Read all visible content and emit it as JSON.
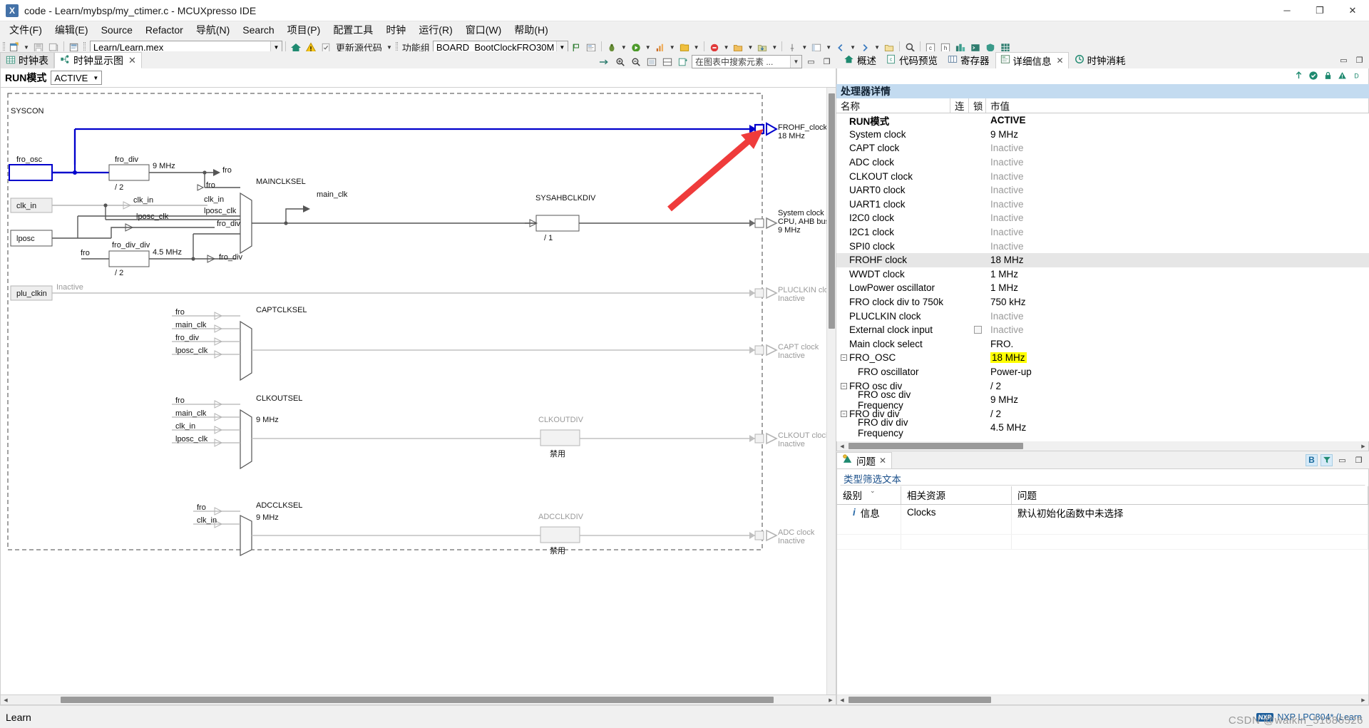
{
  "window": {
    "title": "code - Learn/mybsp/my_ctimer.c - MCUXpresso IDE",
    "app_icon": "X",
    "minimize": "─",
    "maximize": "❐",
    "close": "✕"
  },
  "menubar": {
    "items": [
      "文件(F)",
      "编辑(E)",
      "Source",
      "Refactor",
      "导航(N)",
      "Search",
      "项目(P)",
      "配置工具",
      "时钟",
      "运行(R)",
      "窗口(W)",
      "帮助(H)"
    ]
  },
  "toolbar": {
    "path_value": "Learn/Learn.mex",
    "update_code_label": "更新源代码",
    "function_group_label": "功能组",
    "function_group_value": "BOARD_BootClockFRO30M"
  },
  "editor": {
    "tabs": [
      {
        "label": "时钟表",
        "icon": "table-icon",
        "active": false,
        "closable": false
      },
      {
        "label": "时钟显示图",
        "icon": "diagram-icon",
        "active": true,
        "closable": true
      }
    ],
    "search_placeholder": "在图表中搜索元素 ...",
    "run_mode_label": "RUN模式",
    "run_mode_value": "ACTIVE"
  },
  "diagram": {
    "section_label": "SYSCON",
    "blocks": [
      {
        "name": "fro_osc",
        "label": "fro_osc",
        "sub": ""
      },
      {
        "name": "fro_div",
        "label": "fro_div",
        "sub": "/ 2",
        "out": "9 MHz"
      },
      {
        "name": "clk_in",
        "label": "clk_in",
        "sub": ""
      },
      {
        "name": "lposc",
        "label": "lposc",
        "sub": ""
      },
      {
        "name": "fro_div_div",
        "label": "fro_div_div",
        "sub": "/ 2",
        "out": "4.5 MHz"
      },
      {
        "name": "plu_clkin",
        "label": "plu_clkin",
        "sub": "Inactive"
      },
      {
        "name": "SYSAHBCLKDIV",
        "label": "SYSAHBCLKDIV",
        "sub": "/ 1"
      },
      {
        "name": "CLKOUTDIV",
        "label": "CLKOUTDIV",
        "sub": "禁用",
        "freq": "9 MHz"
      },
      {
        "name": "ADCCLKDIV",
        "label": "ADCCLKDIV",
        "sub": "禁用",
        "freq": "9 MHz"
      }
    ],
    "muxes": [
      {
        "name": "MAINCLKSEL",
        "inputs": [
          "clk_in",
          "fro",
          "lposc_clk",
          "fro_div"
        ],
        "output": "main_clk"
      },
      {
        "name": "CAPTCLKSEL",
        "inputs": [
          "fro",
          "main_clk",
          "fro_div",
          "lposc_clk"
        ],
        "output": ""
      },
      {
        "name": "CLKOUTSEL",
        "inputs": [
          "fro",
          "main_clk",
          "clk_in",
          "lposc_clk"
        ],
        "output": ""
      },
      {
        "name": "ADCCLKSEL",
        "inputs": [
          "fro",
          "clk_in"
        ],
        "output": ""
      }
    ],
    "signals": {
      "fro": "fro",
      "fro2": "fro",
      "clk_in": "clk_in",
      "lposc_clk": "lposc_clk",
      "fro_div": "fro_div",
      "main_clk": "main_clk",
      "fro_label": "fro",
      "fro_div_label": "fro_div"
    },
    "outputs": [
      {
        "name": "FROHF_clock",
        "title": "FROHF_clock",
        "sub": "18 MHz",
        "state": "active-blue"
      },
      {
        "name": "System_clock",
        "title": "System clock",
        "sub": "CPU, AHB bus, :",
        "sub2": "9 MHz",
        "state": "active"
      },
      {
        "name": "PLUCLKIN_clock",
        "title": "PLUCLKIN cloc",
        "sub": "Inactive",
        "state": "inactive"
      },
      {
        "name": "CAPT_clock",
        "title": "CAPT clock",
        "sub": "Inactive",
        "state": "inactive"
      },
      {
        "name": "CLKOUT_clock",
        "title": "CLKOUT clock",
        "sub": "Inactive",
        "state": "inactive"
      },
      {
        "name": "ADC_clock",
        "title": "ADC clock",
        "sub": "Inactive",
        "state": "inactive"
      }
    ]
  },
  "right_panel": {
    "tabs": [
      {
        "label": "概述",
        "icon": "home-icon",
        "active": false,
        "closable": false
      },
      {
        "label": "代码预览",
        "icon": "code-icon",
        "active": false,
        "closable": false
      },
      {
        "label": "寄存器",
        "icon": "register-icon",
        "active": false,
        "closable": false
      },
      {
        "label": "详细信息",
        "icon": "details-icon",
        "active": true,
        "closable": true
      },
      {
        "label": "时钟消耗",
        "icon": "consumption-icon",
        "active": false,
        "closable": false
      }
    ],
    "section_title": "处理器详情",
    "columns": [
      "名称",
      "连",
      "锁",
      "市值"
    ],
    "rows": [
      {
        "name": "RUN模式",
        "value": "ACTIVE",
        "bold": true,
        "indent": 1,
        "state": "normal"
      },
      {
        "name": "System clock",
        "value": "9 MHz",
        "indent": 1,
        "state": "normal"
      },
      {
        "name": "CAPT clock",
        "value": "Inactive",
        "indent": 1,
        "state": "inactive"
      },
      {
        "name": "ADC clock",
        "value": "Inactive",
        "indent": 1,
        "state": "inactive"
      },
      {
        "name": "CLKOUT clock",
        "value": "Inactive",
        "indent": 1,
        "state": "inactive"
      },
      {
        "name": "UART0 clock",
        "value": "Inactive",
        "indent": 1,
        "state": "inactive"
      },
      {
        "name": "UART1 clock",
        "value": "Inactive",
        "indent": 1,
        "state": "inactive"
      },
      {
        "name": "I2C0 clock",
        "value": "Inactive",
        "indent": 1,
        "state": "inactive"
      },
      {
        "name": "I2C1 clock",
        "value": "Inactive",
        "indent": 1,
        "state": "inactive"
      },
      {
        "name": "SPI0 clock",
        "value": "Inactive",
        "indent": 1,
        "state": "inactive"
      },
      {
        "name": "FROHF clock",
        "value": "18 MHz",
        "indent": 1,
        "state": "selected"
      },
      {
        "name": "WWDT clock",
        "value": "1 MHz",
        "indent": 1,
        "state": "normal"
      },
      {
        "name": "LowPower oscillator",
        "value": "1 MHz",
        "indent": 1,
        "state": "normal"
      },
      {
        "name": "FRO clock div to 750k",
        "value": "750 kHz",
        "indent": 1,
        "state": "normal"
      },
      {
        "name": "PLUCLKIN clock",
        "value": "Inactive",
        "indent": 1,
        "state": "inactive"
      },
      {
        "name": "External clock input",
        "value": "Inactive",
        "indent": 1,
        "state": "inactive",
        "lock": true
      },
      {
        "name": "Main clock select",
        "value": "FRO.",
        "indent": 1,
        "state": "normal"
      },
      {
        "name": "FRO_OSC",
        "value": "18 MHz",
        "indent": 0,
        "state": "highlight",
        "twisty": "−"
      },
      {
        "name": "FRO oscillator",
        "value": "Power-up",
        "indent": 2,
        "state": "normal"
      },
      {
        "name": "FRO osc div",
        "value": "/ 2",
        "indent": 0,
        "state": "normal",
        "twisty": "−"
      },
      {
        "name": "FRO osc div Frequency",
        "value": "9 MHz",
        "indent": 2,
        "state": "normal"
      },
      {
        "name": "FRO div div",
        "value": "/ 2",
        "indent": 0,
        "state": "normal",
        "twisty": "−"
      },
      {
        "name": "FRO div div Frequency",
        "value": "4.5 MHz",
        "indent": 2,
        "state": "normal"
      }
    ]
  },
  "problems": {
    "tab_label": "问题",
    "filter_placeholder": "类型筛选文本",
    "toggle_b": "B",
    "columns": [
      "级别",
      "相关资源",
      "问题"
    ],
    "rows": [
      {
        "level": "信息",
        "resource": "Clocks",
        "description": "默认初始化函数中未选择"
      }
    ]
  },
  "statusbar": {
    "left_text": "Learn",
    "device_text": "NXP LPC804* (Learn",
    "nxp_logo": "NXP",
    "watermark": "CSDN @waikin_51686526"
  },
  "colors": {
    "accent_blue": "#0000cc",
    "arrow_red": "#ef3b3b",
    "highlight_yellow": "#ffff00",
    "panel_header": "#c3dbf0",
    "selected_row": "#e6e6e6",
    "inactive_gray": "#9a9a9a"
  }
}
